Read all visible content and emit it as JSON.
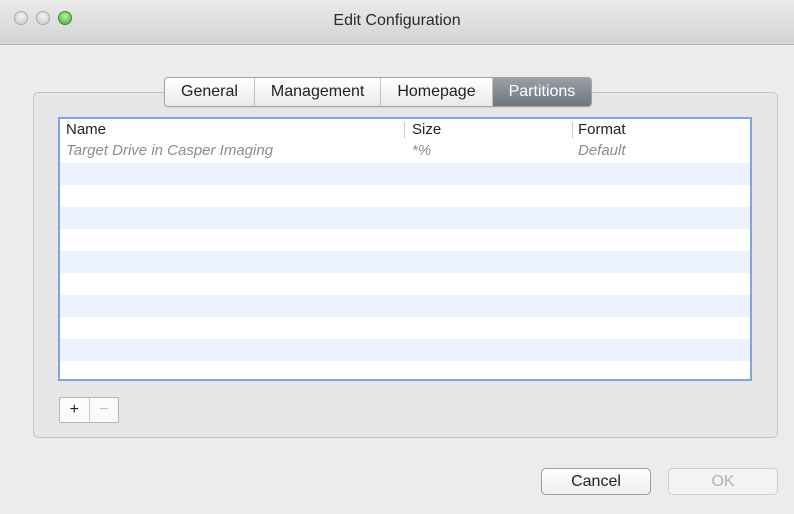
{
  "window": {
    "title": "Edit Configuration"
  },
  "tabs": [
    {
      "label": "General",
      "active": false
    },
    {
      "label": "Management",
      "active": false
    },
    {
      "label": "Homepage",
      "active": false
    },
    {
      "label": "Partitions",
      "active": true
    }
  ],
  "table": {
    "columns": [
      "Name",
      "Size",
      "Format"
    ],
    "rows": [
      {
        "name": "Target Drive in Casper Imaging",
        "size": "*%",
        "format": "Default"
      }
    ]
  },
  "controls": {
    "add_label": "+",
    "remove_label": "−"
  },
  "footer": {
    "cancel_label": "Cancel",
    "ok_label": "OK"
  },
  "colors": {
    "active_tab": "#7d848c",
    "table_focus_border": "#7ea6dc",
    "alt_row": "#edf3fe"
  }
}
